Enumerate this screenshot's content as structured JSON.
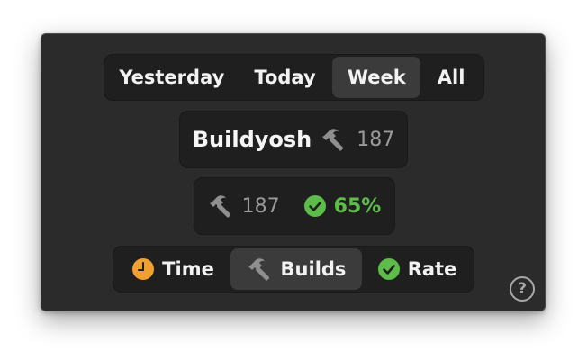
{
  "period_tabs": [
    {
      "label": "Yesterday",
      "selected": false
    },
    {
      "label": "Today",
      "selected": false
    },
    {
      "label": "Week",
      "selected": true
    },
    {
      "label": "All",
      "selected": false
    }
  ],
  "user": {
    "name": "Buildyosh",
    "build_count": "187",
    "icon": "hammer-icon"
  },
  "stats": {
    "build_count": "187",
    "success_rate": "65%",
    "build_icon": "hammer-icon",
    "rate_icon": "check-circle-icon"
  },
  "metric_tabs": [
    {
      "label": "Time",
      "icon": "clock-icon",
      "selected": false
    },
    {
      "label": "Builds",
      "icon": "hammer-icon",
      "selected": true
    },
    {
      "label": "Rate",
      "icon": "check-circle-icon",
      "selected": false
    }
  ],
  "help": {
    "label": "?"
  },
  "colors": {
    "background": "#2b2b2b",
    "pill": "#1f1f1f",
    "selected": "#3b3b3b",
    "success": "#5cbd48",
    "clock": "#f0a030",
    "muted": "#9a9a9a"
  }
}
